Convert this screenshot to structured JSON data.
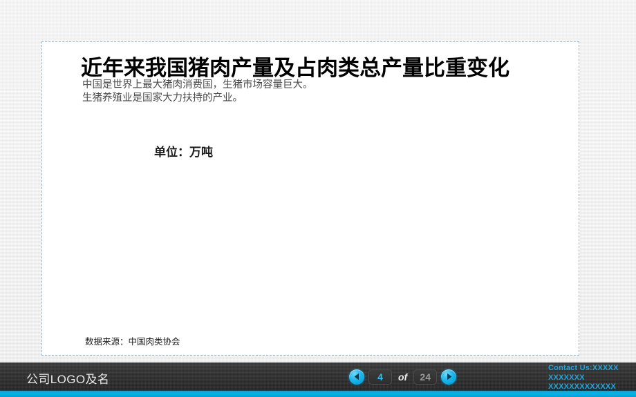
{
  "slide": {
    "title": "近年来我国猪肉产量及占肉类总产量比重变化",
    "subtitle_line1": "中国是世界上最大猪肉消费国，生猪市场容量巨大。",
    "subtitle_line2": "生猪养殖业是国家大力扶持的产业。",
    "unit_label": "单位：万吨",
    "source_note": "数据来源：中国肉类协会"
  },
  "footer": {
    "company_logo": "公司LOGO及名",
    "prev_icon": "chevron-left-icon",
    "next_icon": "chevron-right-icon",
    "current_page": "4",
    "of_label": "of",
    "total_pages": "24",
    "contact_line1": "Contact Us:XXXXX",
    "contact_line2": "XXXXXXX",
    "contact_line3": "XXXXXXXXXXXXX"
  },
  "colors": {
    "accent_cyan": "#07b2e6",
    "bar_dark": "#2e2e2e",
    "canvas_gray": "#e8e8e8",
    "content_white": "#ffffff",
    "dashed_border": "#9fb4c4",
    "contact_text": "#1fa8e0"
  }
}
